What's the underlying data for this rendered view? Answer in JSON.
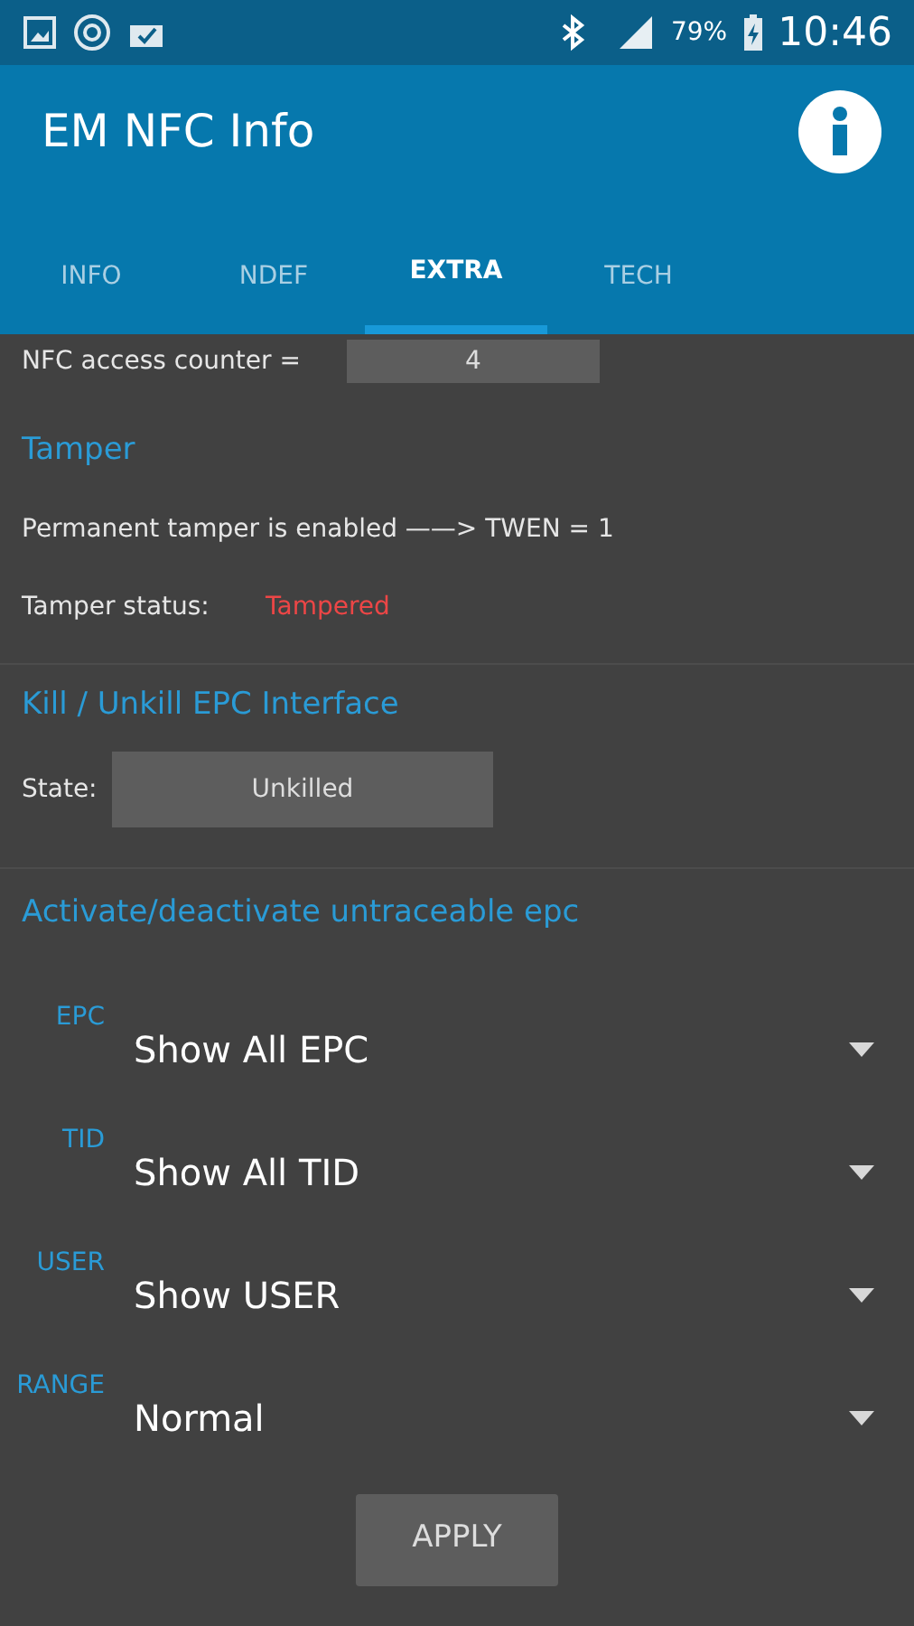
{
  "status_bar": {
    "battery": "79%",
    "time": "10:46"
  },
  "app_bar": {
    "title": "EM NFC Info"
  },
  "tabs": [
    {
      "label": "INFO",
      "selected": false
    },
    {
      "label": "NDEF",
      "selected": false
    },
    {
      "label": "EXTRA",
      "selected": true
    },
    {
      "label": "TECH",
      "selected": false
    }
  ],
  "access_counter": {
    "label": "NFC access counter =",
    "value": "4"
  },
  "tamper": {
    "heading": "Tamper",
    "message": "Permanent tamper is enabled ——> TWEN = 1",
    "status_label": "Tamper status:",
    "status_value": "Tampered"
  },
  "kill": {
    "heading": "Kill / Unkill EPC Interface",
    "state_label": "State:",
    "state_button": "Unkilled"
  },
  "untraceable": {
    "heading": "Activate/deactivate untraceable epc",
    "dropdowns": [
      {
        "label": "EPC",
        "value": "Show All EPC"
      },
      {
        "label": "TID",
        "value": "Show All TID"
      },
      {
        "label": "USER",
        "value": "Show USER"
      },
      {
        "label": "RANGE",
        "value": "Normal"
      }
    ],
    "apply_button": "APPLY"
  }
}
